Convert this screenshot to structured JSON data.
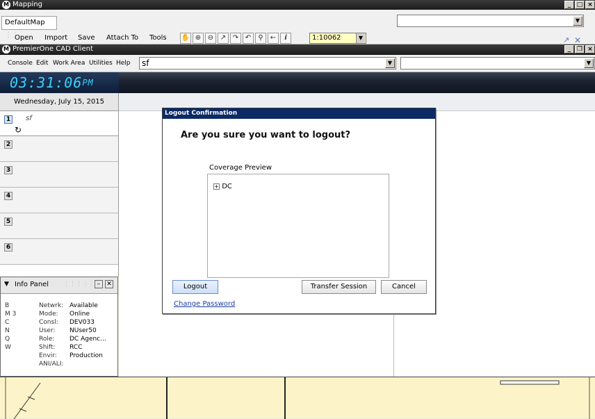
{
  "mapping_window": {
    "title": "Mapping",
    "map_tab": "DefaultMap",
    "menu": [
      "Open",
      "Import",
      "Save",
      "Attach To",
      "Tools"
    ],
    "scale": "1:10062",
    "search_value": ""
  },
  "cad_window": {
    "title": "PremierOne CAD Client",
    "menu": [
      "Console",
      "Edit",
      "Work Area",
      "Utilities",
      "Help"
    ],
    "command_value": "sf",
    "right_combo_value": ""
  },
  "clock": {
    "time": "03:31:06",
    "ampm": "PM",
    "date": "Wednesday, July 15, 2015"
  },
  "slots": [
    {
      "num": "1",
      "label": "sf"
    },
    {
      "num": "2",
      "label": ""
    },
    {
      "num": "3",
      "label": ""
    },
    {
      "num": "4",
      "label": ""
    },
    {
      "num": "5",
      "label": ""
    },
    {
      "num": "6",
      "label": ""
    }
  ],
  "info_panel": {
    "title": "Info Panel",
    "left_letters": [
      "B",
      "M  3",
      "C",
      "N",
      "Q",
      "W"
    ],
    "rows": [
      {
        "k": "Netwrk:",
        "v": "Available"
      },
      {
        "k": "Mode:",
        "v": "Online"
      },
      {
        "k": "Consl:",
        "v": "DEV033"
      },
      {
        "k": "User:",
        "v": "NUser50"
      },
      {
        "k": "Role:",
        "v": "DC Agenc..."
      },
      {
        "k": "Shift:",
        "v": "RCC"
      },
      {
        "k": "Envir:",
        "v": "Production"
      },
      {
        "k": "ANI/ALI:",
        "v": ""
      }
    ]
  },
  "dialog": {
    "title": "Logout Confirmation",
    "question": "Are you sure you want to logout?",
    "coverage_label": "Coverage Preview",
    "tree_item": "DC",
    "buttons": {
      "logout": "Logout",
      "transfer": "Transfer Session",
      "cancel": "Cancel"
    },
    "change_password": "Change Password"
  },
  "colors": {
    "dialog_title_bg": "#0b2a66",
    "clock_text": "#3bd0ff",
    "map_bg": "#fcf4c8",
    "scale_bg": "#ffffc0"
  }
}
